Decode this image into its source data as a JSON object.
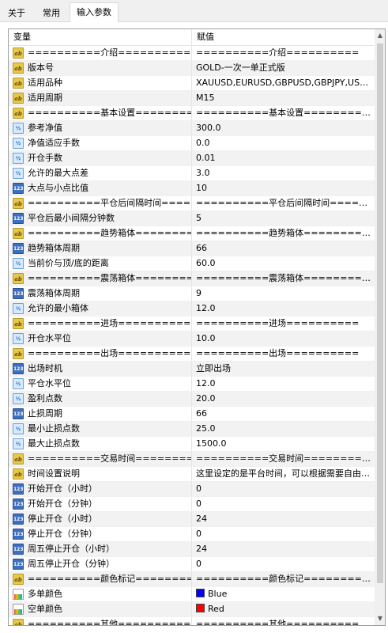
{
  "tabs": [
    {
      "label": "关于"
    },
    {
      "label": "常用"
    },
    {
      "label": "输入参数"
    }
  ],
  "columns": {
    "variable": "变量",
    "value": "赋值"
  },
  "rows": [
    {
      "icon": "ab",
      "name": "==========介绍==========",
      "value": "==========介绍=========="
    },
    {
      "icon": "ab",
      "name": "版本号",
      "value": "GOLD-一次一单正式版"
    },
    {
      "icon": "ab",
      "name": "适用品种",
      "value": "XAUUSD,EURUSD,GBPUSD,GBPJPY,USDJPY,..."
    },
    {
      "icon": "ab",
      "name": "适用周期",
      "value": "M15"
    },
    {
      "icon": "ab",
      "name": "==========基本设置==========",
      "value": "==========基本设置=========="
    },
    {
      "icon": "half",
      "name": "参考净值",
      "value": "300.0"
    },
    {
      "icon": "half",
      "name": "净值适应手数",
      "value": "0.0"
    },
    {
      "icon": "half",
      "name": "开仓手数",
      "value": "0.01"
    },
    {
      "icon": "half",
      "name": "允许的最大点差",
      "value": "3.0"
    },
    {
      "icon": "123",
      "name": "大点与小点比值",
      "value": "10"
    },
    {
      "icon": "ab",
      "name": "==========平仓后间隔时间=======...",
      "value": "==========平仓后间隔时间=========="
    },
    {
      "icon": "123",
      "name": "平仓后最小间隔分钟数",
      "value": "5"
    },
    {
      "icon": "ab",
      "name": "==========趋势箱体==========",
      "value": "==========趋势箱体=========="
    },
    {
      "icon": "123",
      "name": "趋势箱体周期",
      "value": "66"
    },
    {
      "icon": "half",
      "name": "当前价与顶/底的距离",
      "value": "60.0"
    },
    {
      "icon": "ab",
      "name": "==========震荡箱体==========",
      "value": "==========震荡箱体=========="
    },
    {
      "icon": "123",
      "name": "震荡箱体周期",
      "value": "9"
    },
    {
      "icon": "half",
      "name": "允许的最小箱体",
      "value": "12.0"
    },
    {
      "icon": "ab",
      "name": "==========进场==========",
      "value": "==========进场=========="
    },
    {
      "icon": "half",
      "name": "开仓水平位",
      "value": "10.0"
    },
    {
      "icon": "ab",
      "name": "==========出场==========",
      "value": "==========出场=========="
    },
    {
      "icon": "123",
      "name": "出场时机",
      "value": "立即出场"
    },
    {
      "icon": "half",
      "name": "平仓水平位",
      "value": "12.0"
    },
    {
      "icon": "half",
      "name": "盈利点数",
      "value": "20.0"
    },
    {
      "icon": "123",
      "name": "止损周期",
      "value": "66"
    },
    {
      "icon": "half",
      "name": "最小止损点数",
      "value": "25.0"
    },
    {
      "icon": "half",
      "name": "最大止损点数",
      "value": "1500.0"
    },
    {
      "icon": "ab",
      "name": "==========交易时间==========",
      "value": "==========交易时间=========="
    },
    {
      "icon": "ab",
      "name": "时间设置说明",
      "value": "这里设定的是平台时间，可以根据需要自由调..."
    },
    {
      "icon": "123",
      "name": "开始开仓（小时）",
      "value": "0"
    },
    {
      "icon": "123",
      "name": "开始开仓（分钟）",
      "value": "0"
    },
    {
      "icon": "123",
      "name": "停止开仓（小时）",
      "value": "24"
    },
    {
      "icon": "123",
      "name": "停止开仓（分钟）",
      "value": "0"
    },
    {
      "icon": "123",
      "name": "周五停止开仓（小时）",
      "value": "24"
    },
    {
      "icon": "123",
      "name": "周五停止开仓（分钟）",
      "value": "0"
    },
    {
      "icon": "ab",
      "name": "==========颜色标记==========",
      "value": "==========颜色标记=========="
    },
    {
      "icon": "color",
      "name": "多单颜色",
      "value": "Blue",
      "swatch": "#0000ff"
    },
    {
      "icon": "color",
      "name": "空单颜色",
      "value": "Red",
      "swatch": "#ff0000"
    },
    {
      "icon": "ab",
      "name": "==========其他==========",
      "value": "==========其他=========="
    }
  ]
}
